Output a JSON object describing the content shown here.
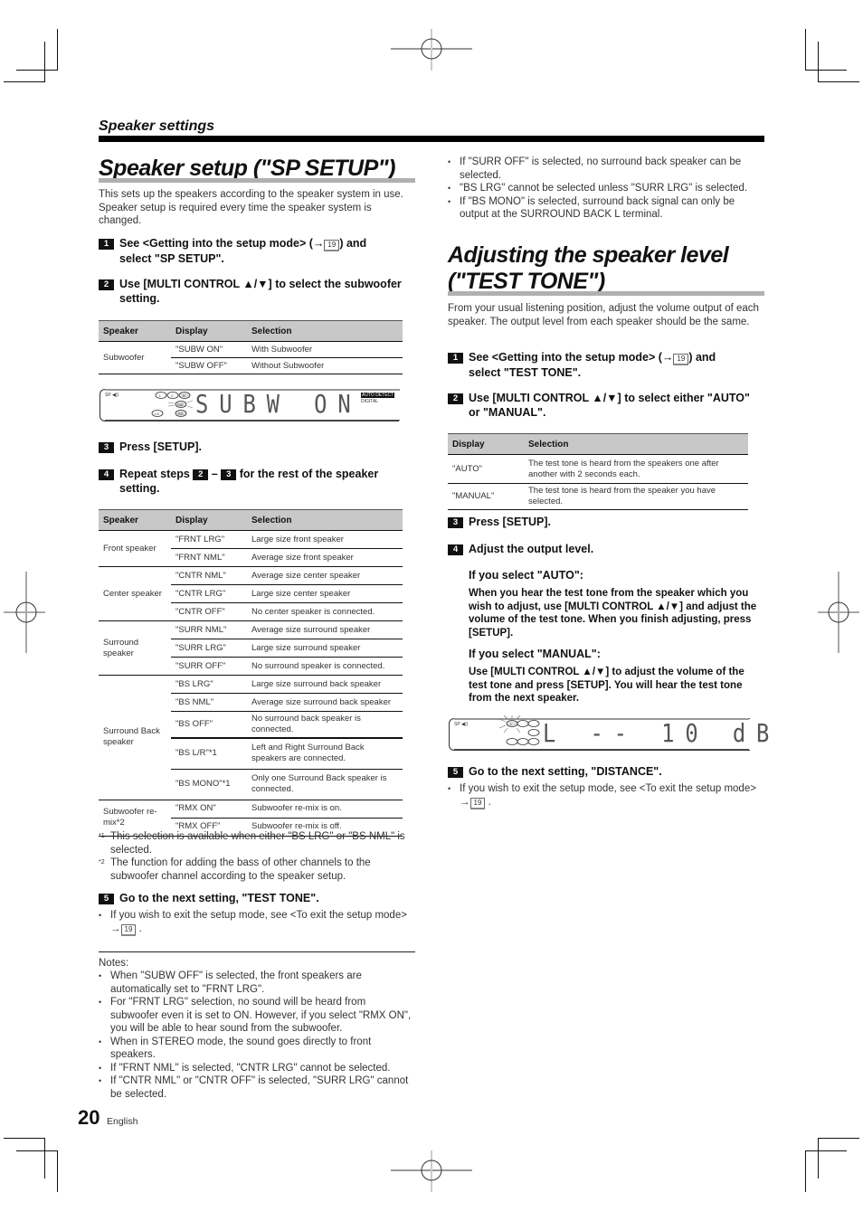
{
  "section": {
    "title": "Speaker settings"
  },
  "left": {
    "title": "Speaker setup (\"SP SETUP\")",
    "intro": "This sets up the speakers according to the speaker system in use. Speaker setup is required every time the speaker system is changed.",
    "step1": {
      "num": "1",
      "pre": "See <Getting into the setup mode> (→",
      "ref": "19",
      "post": ") and",
      "line2": "select \"SP SETUP\"."
    },
    "step2": {
      "num": "2",
      "line1": "Use [MULTI CONTROL ▲/▼] to select the subwoofer",
      "line2": "setting."
    },
    "table1": {
      "headers": [
        "Speaker",
        "Display",
        "Selection"
      ],
      "groups": [
        {
          "speaker": "Subwoofer",
          "rows": [
            {
              "display": "\"SUBW ON\"",
              "selection": "With Subwoofer"
            },
            {
              "display": "\"SUBW OFF\"",
              "selection": "Without Subwoofer"
            }
          ]
        }
      ]
    },
    "display1": {
      "indicator": "SP ◀))",
      "speakers": [
        "L",
        "C",
        "R",
        "SW",
        "LS",
        "RS"
      ],
      "text": "SUBW   ON",
      "badge1": "AUTO DETECT",
      "badge2": "DIGITAL"
    },
    "step3": {
      "num": "3",
      "text": "Press [SETUP]."
    },
    "step4": {
      "num": "4",
      "pre": "Repeat steps",
      "ref1": "2",
      "dash": "–",
      "ref2": "3",
      "post": "for the rest of the speaker",
      "line2": "setting."
    },
    "table2": {
      "headers": [
        "Speaker",
        "Display",
        "Selection"
      ],
      "groups": [
        {
          "speaker": "Front speaker",
          "rows": [
            {
              "display": "\"FRNT LRG\"",
              "selection": "Large size front speaker"
            },
            {
              "display": "\"FRNT NML\"",
              "selection": "Average size front speaker"
            }
          ]
        },
        {
          "speaker": "Center speaker",
          "rows": [
            {
              "display": "\"CNTR NML\"",
              "selection": "Average size center speaker"
            },
            {
              "display": "\"CNTR LRG\"",
              "selection": "Large size center speaker"
            },
            {
              "display": "\"CNTR OFF\"",
              "selection": "No center speaker is connected."
            }
          ]
        },
        {
          "speaker": "Surround speaker",
          "rows": [
            {
              "display": "\"SURR NML\"",
              "selection": "Average size surround speaker"
            },
            {
              "display": "\"SURR LRG\"",
              "selection": "Large size surround speaker"
            },
            {
              "display": "\"SURR OFF\"",
              "selection": "No surround speaker is connected."
            }
          ]
        },
        {
          "speaker": "Surround Back speaker",
          "rows": [
            {
              "display": "\"BS LRG\"",
              "selection": "Large size surround back speaker"
            },
            {
              "display": "\"BS NML\"",
              "selection": "Average size surround back speaker"
            },
            {
              "display": "\"BS OFF\"",
              "selection": "No surround back speaker is connected."
            },
            {
              "display": "\"BS L/R\"*1",
              "selection": "Left and Right Surround Back speakers are connected."
            },
            {
              "display": "\"BS MONO\"*1",
              "selection": "Only one Surround Back speaker is connected."
            }
          ]
        },
        {
          "speaker": "Subwoofer re-mix*2",
          "rows": [
            {
              "display": "\"RMX ON\"",
              "selection": "Subwoofer re-mix is on."
            },
            {
              "display": "\"RMX OFF\"",
              "selection": "Subwoofer re-mix is off."
            }
          ]
        }
      ]
    },
    "footnotes": [
      {
        "mark": "*1",
        "text": "This selection is available when either \"BS LRG\" or \"BS NML\" is selected."
      },
      {
        "mark": "*2",
        "text": "The function for adding the bass of other channels to the subwoofer channel according to the speaker setup."
      }
    ],
    "step5": {
      "num": "5",
      "text": "Go to the next setting, \"TEST TONE\"."
    },
    "step5_note": {
      "text": "If you wish to exit the setup mode, see <To exit the setup mode>",
      "arrow": "→",
      "ref": "19"
    },
    "notes_title": "Notes:",
    "notes": [
      "When \"SUBW OFF\" is selected, the front speakers are automatically set to \"FRNT LRG\".",
      "For \"FRNT LRG\" selection, no sound will be heard from subwoofer even it is set to ON. However, if you select \"RMX ON\", you will be able to hear sound from the subwoofer.",
      "When in STEREO mode, the sound goes directly to front speakers.",
      "If \"FRNT NML\" is selected, \"CNTR LRG\" cannot be selected.",
      "If \"CNTR NML\" or \"CNTR OFF\" is selected, \"SURR LRG\" cannot be selected."
    ]
  },
  "right": {
    "notes_cont": [
      "If \"SURR OFF\" is selected, no surround back speaker can be selected.",
      "\"BS LRG\" cannot be selected unless \"SURR LRG\" is selected.",
      "If \"BS MONO\" is selected, surround back signal can only be output at the SURROUND BACK L terminal."
    ],
    "title_line1": "Adjusting the speaker level",
    "title_line2": "(\"TEST TONE\")",
    "intro": "From your usual listening position, adjust the volume output of each speaker. The output level from each speaker should be the same.",
    "step1": {
      "num": "1",
      "pre": "See <Getting into the setup mode> (→",
      "ref": "19",
      "post": ") and",
      "line2": "select \"TEST TONE\"."
    },
    "step2": {
      "num": "2",
      "line1": "Use [MULTI CONTROL ▲/▼] to select either \"AUTO\"",
      "line2": "or \"MANUAL\"."
    },
    "table": {
      "headers": [
        "Display",
        "Selection"
      ],
      "rows": [
        {
          "display": "\"AUTO\"",
          "selection": "The test tone is heard from the speakers one after another with 2 seconds each."
        },
        {
          "display": "\"MANUAL\"",
          "selection": "The test tone is heard from the speaker you have selected."
        }
      ]
    },
    "step3": {
      "num": "3",
      "text": "Press [SETUP]."
    },
    "step4": {
      "num": "4",
      "text": "Adjust the output level."
    },
    "auto_title": "If you select \"AUTO\":",
    "auto_body": "When you hear the test tone from the speaker which you wish to adjust, use [MULTI CONTROL ▲/▼] and adjust the volume of the test tone. When you finish adjusting, press [SETUP].",
    "manual_title": "If you select \"MANUAL\":",
    "manual_body": "Use [MULTI CONTROL ▲/▼] to adjust the volume of the test tone and press [SETUP]. You will hear the test tone from the next speaker.",
    "display2": {
      "indicator": "SP ◀))",
      "speaker": "L",
      "text": "L   -- 10 dB"
    },
    "step5": {
      "num": "5",
      "text": "Go to the next setting, \"DISTANCE\"."
    },
    "step5_note": {
      "text": "If you wish to exit the setup mode, see <To exit the setup mode>",
      "arrow": "→",
      "ref": "19"
    }
  },
  "footer": {
    "page": "20",
    "language": "English"
  }
}
